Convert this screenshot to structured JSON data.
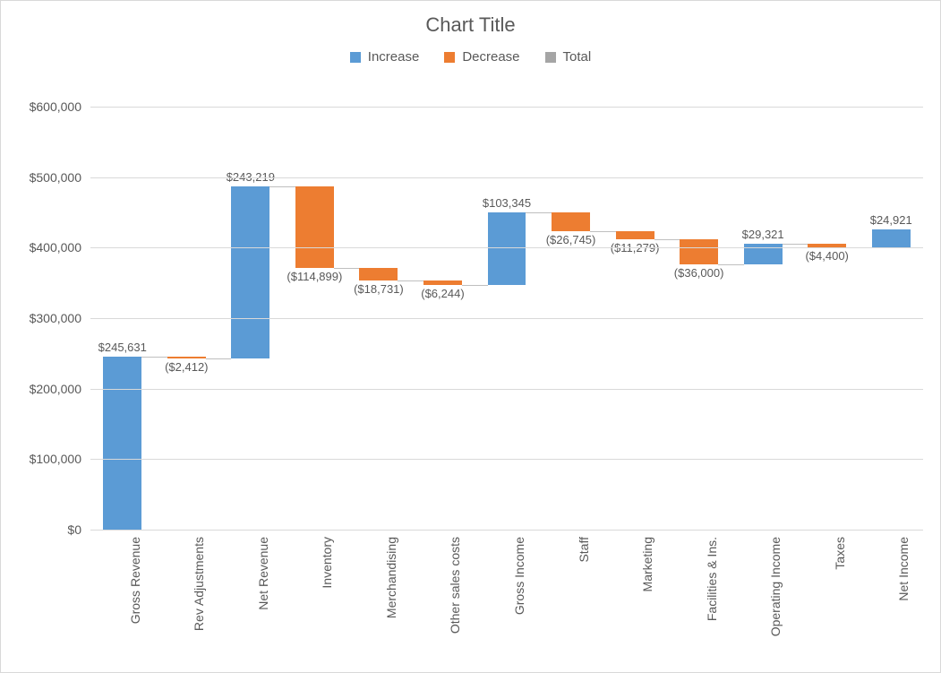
{
  "chart_data": {
    "type": "waterfall",
    "title": "Chart Title",
    "legend": [
      {
        "name": "Increase",
        "color": "#5B9BD5"
      },
      {
        "name": "Decrease",
        "color": "#ED7D31"
      },
      {
        "name": "Total",
        "color": "#A5A5A5"
      }
    ],
    "ylabel": "",
    "xlabel": "",
    "ylim": [
      0,
      600000
    ],
    "ytick_step": 100000,
    "yticks": [
      "$0",
      "$100,000",
      "$200,000",
      "$300,000",
      "$400,000",
      "$500,000",
      "$600,000"
    ],
    "categories": [
      "Gross Revenue",
      "Rev Adjustments",
      "Net Revenue",
      "Inventory",
      "Merchandising",
      "Other sales costs",
      "Gross Income",
      "Staff",
      "Marketing",
      "Facilities & Ins.",
      "Operating Income",
      "Taxes",
      "Net Income"
    ],
    "items": [
      {
        "name": "Gross Revenue",
        "kind": "increase",
        "base": 0,
        "delta": 245631,
        "label": "$245,631",
        "label_pos": "top"
      },
      {
        "name": "Rev Adjustments",
        "kind": "decrease",
        "base": 245631,
        "delta": -2412,
        "label": "($2,412)",
        "label_pos": "bottom"
      },
      {
        "name": "Net Revenue",
        "kind": "increase",
        "base": 243219,
        "delta": 243219,
        "label": "$243,219",
        "label_pos": "top"
      },
      {
        "name": "Inventory",
        "kind": "decrease",
        "base": 486438,
        "delta": -114899,
        "label": "($114,899)",
        "label_pos": "bottom"
      },
      {
        "name": "Merchandising",
        "kind": "decrease",
        "base": 371539,
        "delta": -18731,
        "label": "($18,731)",
        "label_pos": "bottom"
      },
      {
        "name": "Other sales costs",
        "kind": "decrease",
        "base": 352808,
        "delta": -6244,
        "label": "($6,244)",
        "label_pos": "bottom"
      },
      {
        "name": "Gross Income",
        "kind": "increase",
        "base": 346564,
        "delta": 103345,
        "label": "$103,345",
        "label_pos": "top"
      },
      {
        "name": "Staff",
        "kind": "decrease",
        "base": 449909,
        "delta": -26745,
        "label": "($26,745)",
        "label_pos": "bottom"
      },
      {
        "name": "Marketing",
        "kind": "decrease",
        "base": 423164,
        "delta": -11279,
        "label": "($11,279)",
        "label_pos": "bottom"
      },
      {
        "name": "Facilities & Ins.",
        "kind": "decrease",
        "base": 411885,
        "delta": -36000,
        "label": "($36,000)",
        "label_pos": "bottom"
      },
      {
        "name": "Operating Income",
        "kind": "increase",
        "base": 375885,
        "delta": 29321,
        "label": "$29,321",
        "label_pos": "top"
      },
      {
        "name": "Taxes",
        "kind": "decrease",
        "base": 405206,
        "delta": -4400,
        "label": "($4,400)",
        "label_pos": "bottom"
      },
      {
        "name": "Net Income",
        "kind": "increase",
        "base": 400806,
        "delta": 24921,
        "label": "$24,921",
        "label_pos": "top"
      }
    ]
  }
}
